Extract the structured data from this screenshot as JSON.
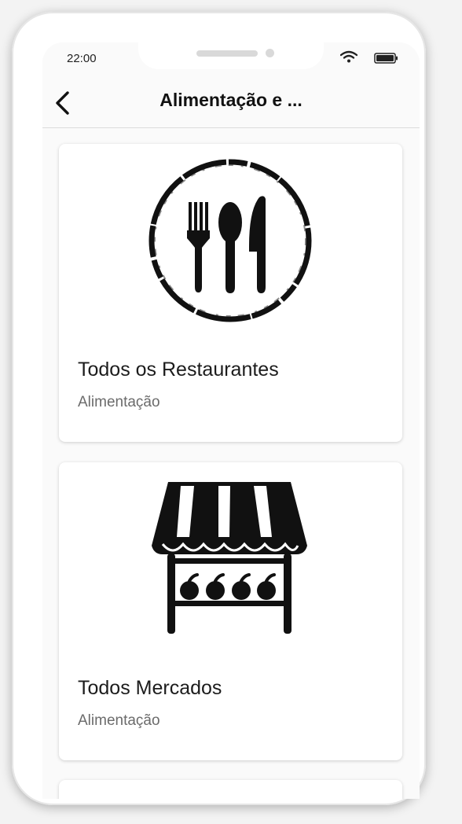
{
  "status_bar": {
    "time": "22:00"
  },
  "header": {
    "title": "Alimentação e ..."
  },
  "cards": [
    {
      "title": "Todos os Restaurantes",
      "subtitle": "Alimentação",
      "icon": "restaurant-cutlery-icon"
    },
    {
      "title": "Todos Mercados",
      "subtitle": "Alimentação",
      "icon": "market-stall-icon"
    }
  ],
  "colors": {
    "background": "#fafafa",
    "card": "#ffffff",
    "icon": "#111111"
  }
}
